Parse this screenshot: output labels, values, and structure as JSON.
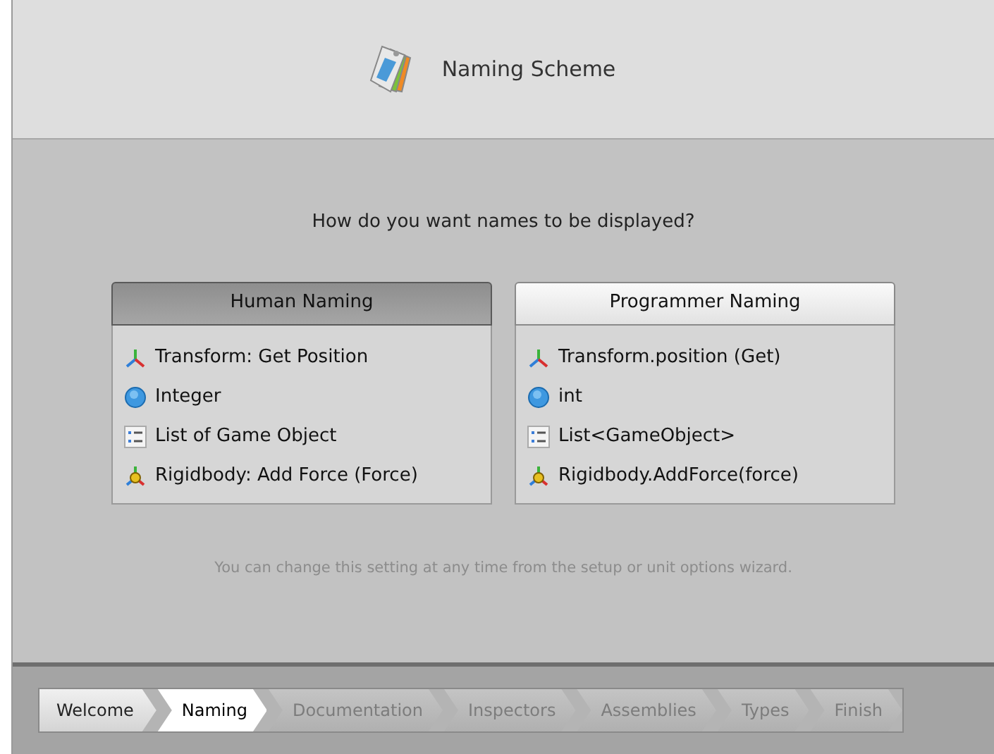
{
  "header": {
    "title": "Naming Scheme"
  },
  "question": "How do you want names to be displayed?",
  "options": [
    {
      "label": "Human Naming",
      "selected": true,
      "items": [
        {
          "kind": "transform",
          "text": "Transform: Get Position"
        },
        {
          "kind": "integer",
          "text": "Integer"
        },
        {
          "kind": "list",
          "text": "List of Game Object"
        },
        {
          "kind": "rigidbody",
          "text": "Rigidbody: Add Force (Force)"
        }
      ]
    },
    {
      "label": "Programmer Naming",
      "selected": false,
      "items": [
        {
          "kind": "transform",
          "text": "Transform.position (Get)"
        },
        {
          "kind": "integer",
          "text": "int"
        },
        {
          "kind": "list",
          "text": "List<GameObject>"
        },
        {
          "kind": "rigidbody",
          "text": "Rigidbody.AddForce(force)"
        }
      ]
    }
  ],
  "hint": "You can change this setting at any time from the setup or unit options wizard.",
  "steps": [
    {
      "label": "Welcome",
      "selected": false,
      "completed": true
    },
    {
      "label": "Naming",
      "selected": true,
      "completed": false
    },
    {
      "label": "Documentation",
      "selected": false,
      "completed": false
    },
    {
      "label": "Inspectors",
      "selected": false,
      "completed": false
    },
    {
      "label": "Assemblies",
      "selected": false,
      "completed": false
    },
    {
      "label": "Types",
      "selected": false,
      "completed": false
    },
    {
      "label": "Finish",
      "selected": false,
      "completed": false
    }
  ]
}
